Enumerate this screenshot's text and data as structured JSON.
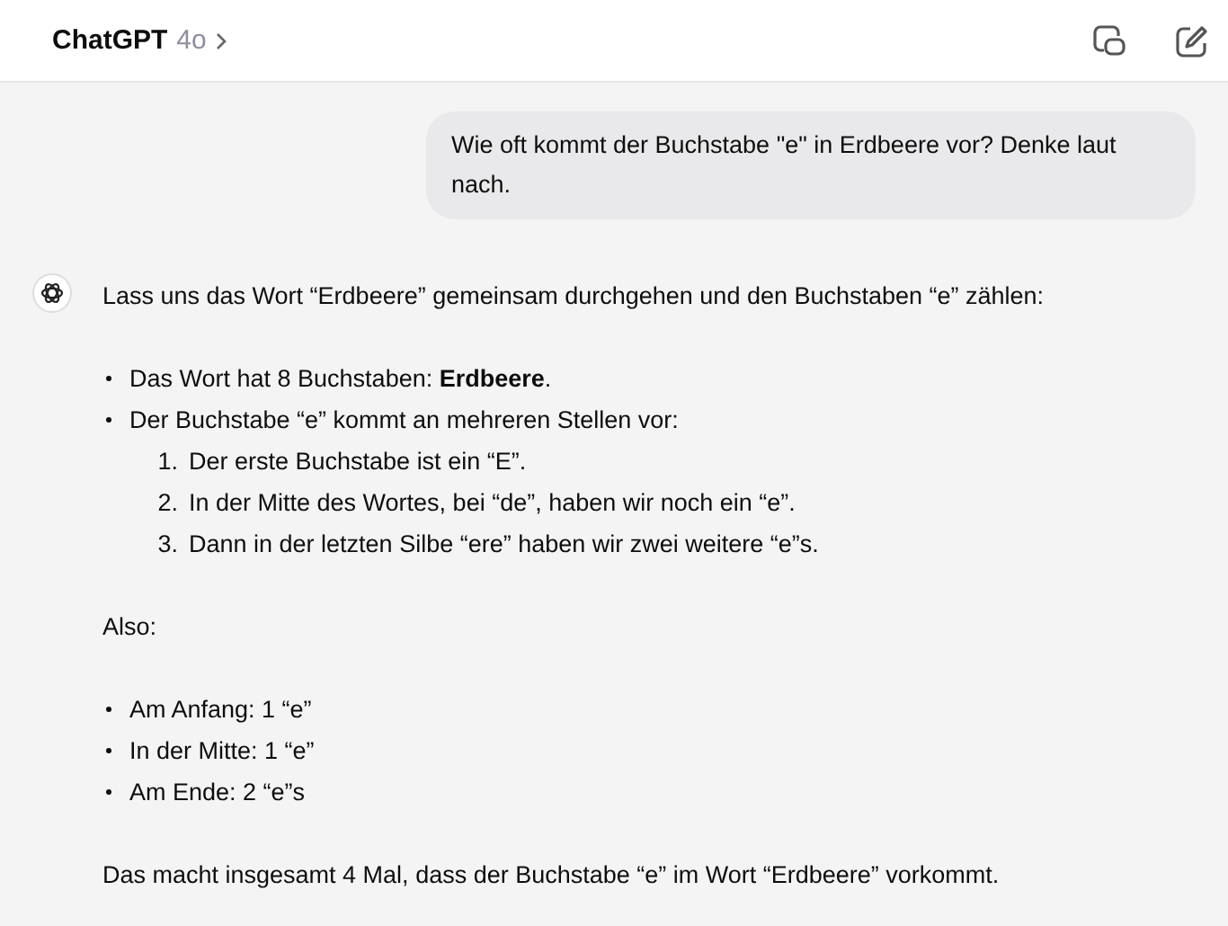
{
  "header": {
    "title": "ChatGPT",
    "model": "4o"
  },
  "user_message": {
    "text": "Wie oft kommt der Buchstabe \"e\" in Erdbeere vor? Denke laut nach."
  },
  "assistant_message": {
    "blocks": [
      {
        "kind": "paragraph",
        "text": "Lass uns das Wort “Erdbeere” gemeinsam durchgehen und den Buchstaben “e” zählen:"
      },
      {
        "kind": "bullets",
        "items": [
          {
            "text": "Das Wort hat 8 Buchstaben: **Erdbeere**."
          },
          {
            "text": "Der Buchstabe “e” kommt an mehreren Stellen vor:",
            "children": [
              {
                "number": "1.",
                "text": "Der erste Buchstabe ist ein “E”."
              },
              {
                "number": "2.",
                "text": "In der Mitte des Wortes, bei “de”, haben wir noch ein “e”."
              },
              {
                "number": "3.",
                "text": "Dann in der letzten Silbe “ere” haben wir zwei weitere “e”s."
              }
            ]
          }
        ]
      },
      {
        "kind": "paragraph",
        "text": "Also:"
      },
      {
        "kind": "bullets",
        "items": [
          {
            "text": "Am Anfang: 1 “e”"
          },
          {
            "text": "In der Mitte: 1 “e”"
          },
          {
            "text": "Am Ende: 2 “e”s"
          }
        ]
      },
      {
        "kind": "paragraph",
        "text": "Das macht insgesamt 4 Mal, dass der Buchstabe “e” im Wort “Erdbeere” vorkommt."
      }
    ]
  }
}
